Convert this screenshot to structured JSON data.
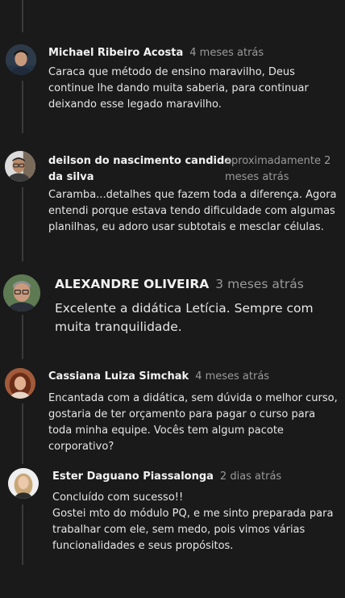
{
  "comments": [
    {
      "name": "Michael Ribeiro Acosta",
      "time": "4 meses atrás",
      "text": "Caraca que método de ensino maravilho, Deus continue lhe dando muita saberia, para continuar deixando esse legado maravilho.",
      "avatar": "man-dark-hair-avatar"
    },
    {
      "name": "deilson do nascimento candido da silva",
      "name_line1": "deilson do nascimento candido",
      "name_line2": "da silva",
      "time": "aproximadamente 2 meses atrás",
      "time_line1": "aproximadamente 2",
      "time_line2": "meses atrás",
      "text": "Caramba...detalhes que fazem toda a diferença. Agora entendi porque estava tendo dificuldade com algumas planilhas, eu adoro usar subtotais e mesclar células.",
      "avatar": "man-glasses-avatar"
    },
    {
      "name": "ALEXANDRE OLIVEIRA",
      "time": "3 meses atrás",
      "text": "Excelente a didática Letícia. Sempre com muita tranquilidade.",
      "avatar": "man-grey-hair-avatar"
    },
    {
      "name": "Cassiana Luiza Simchak",
      "time": "4 meses atrás",
      "text": "Encantada com a didática, sem dúvida o melhor curso, gostaria de ter orçamento para pagar o curso para toda minha equipe. Vocês tem algum pacote corporativo?",
      "avatar": "woman-curly-hair-avatar"
    },
    {
      "name": "Ester Daguano Piassalonga",
      "time": "2 dias atrás",
      "text_line1": "Concluído com sucesso!!",
      "text_line2": "Gostei mto do módulo PQ, e me sinto preparada para trabalhar com ele, sem medo, pois vimos várias funcionalidades e seus propósitos.",
      "avatar": "woman-blonde-avatar"
    }
  ],
  "colors": {
    "background": "#1a1a1a",
    "name": "#f2f2f2",
    "time": "#9a9a9a",
    "text": "#e6e6e6",
    "thread_line": "#3a3a3a"
  }
}
